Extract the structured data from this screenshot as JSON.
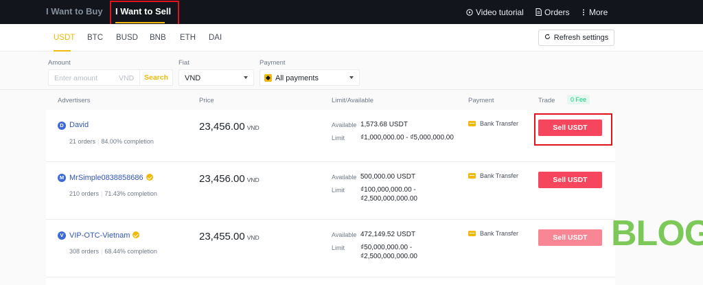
{
  "topbar": {
    "tab_buy": "I Want to Buy",
    "tab_sell": "I Want to Sell",
    "video_tutorial": "Video tutorial",
    "orders": "Orders",
    "more": "More"
  },
  "assets": [
    "USDT",
    "BTC",
    "BUSD",
    "BNB",
    "ETH",
    "DAI"
  ],
  "refresh_label": "Refresh settings",
  "filters": {
    "amount_label": "Amount",
    "amount_placeholder": "Enter amount",
    "amount_currency": "VND",
    "search_label": "Search",
    "fiat_label": "Fiat",
    "fiat_value": "VND",
    "payment_label": "Payment",
    "payment_value": "All payments"
  },
  "table": {
    "headers": {
      "advertisers": "Advertisers",
      "price": "Price",
      "limit": "Limit/Available",
      "payment": "Payment",
      "trade": "Trade",
      "fee": "0 Fee"
    },
    "rows": [
      {
        "initial": "D",
        "name": "David",
        "orders": "21 orders",
        "completion": "84.00% completion",
        "price": "23,456.00",
        "currency": "VND",
        "available_label": "Available",
        "available": "1,573.68 USDT",
        "limit_label": "Limit",
        "limit_line1": "₫1,000,000.00 - ₫5,000,000.00",
        "limit_line2": "",
        "payment": "Bank Transfer",
        "action": "Sell USDT"
      },
      {
        "initial": "M",
        "name": "MrSimple0838858686",
        "orders": "210 orders",
        "completion": "71.43% completion",
        "price": "23,456.00",
        "currency": "VND",
        "available_label": "Available",
        "available": "500,000.00 USDT",
        "limit_label": "Limit",
        "limit_line1": "₫100,000,000.00 -",
        "limit_line2": "₫2,500,000,000.00",
        "payment": "Bank Transfer",
        "action": "Sell USDT"
      },
      {
        "initial": "V",
        "name": "VIP-OTC-Vietnam",
        "orders": "308 orders",
        "completion": "68.44% completion",
        "price": "23,455.00",
        "currency": "VND",
        "available_label": "Available",
        "available": "472,149.52 USDT",
        "limit_label": "Limit",
        "limit_line1": "₫50,000,000.00 -",
        "limit_line2": "₫2,500,000,000.00",
        "payment": "Bank Transfer",
        "action": "Sell USDT"
      }
    ]
  },
  "watermark": "BLOG",
  "colors": {
    "accent": "#f0b90b",
    "sell": "#f6465d",
    "topbar": "#12161c",
    "highlight": "#e0131d",
    "watermark": "#7cc95a"
  }
}
